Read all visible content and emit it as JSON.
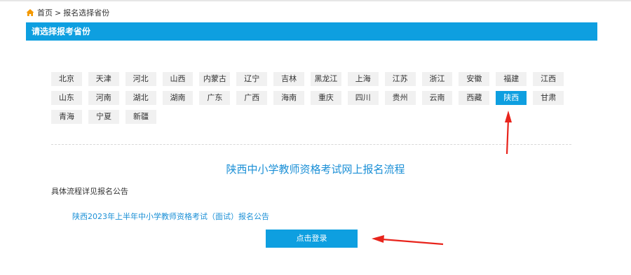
{
  "breadcrumb": {
    "home": "首页",
    "separator": ">",
    "current": "报名选择省份"
  },
  "banner": {
    "title": "请选择报考省份"
  },
  "provinces": {
    "row1": [
      "北京",
      "天津",
      "河北",
      "山西",
      "内蒙古",
      "辽宁",
      "吉林",
      "黑龙江",
      "上海",
      "江苏",
      "浙江",
      "安徽",
      "福建",
      "江西"
    ],
    "row2": [
      "山东",
      "河南",
      "湖北",
      "湖南",
      "广东",
      "广西",
      "海南",
      "重庆",
      "四川",
      "贵州",
      "云南",
      "西藏",
      "陕西",
      "甘肃"
    ],
    "row3": [
      "青海",
      "宁夏",
      "新疆"
    ],
    "selected": "陕西"
  },
  "flow": {
    "title": "陕西中小学教师资格考试网上报名流程",
    "note": "具体流程详见报名公告",
    "notice_link": "陕西2023年上半年中小学教师资格考试（面试）报名公告"
  },
  "login_button": "点击登录",
  "colors": {
    "accent": "#0e9fe0",
    "link": "#1a8fd6",
    "home_icon": "#f39800",
    "annotation": "#e8241c"
  },
  "icons": {
    "home": "home-icon"
  }
}
